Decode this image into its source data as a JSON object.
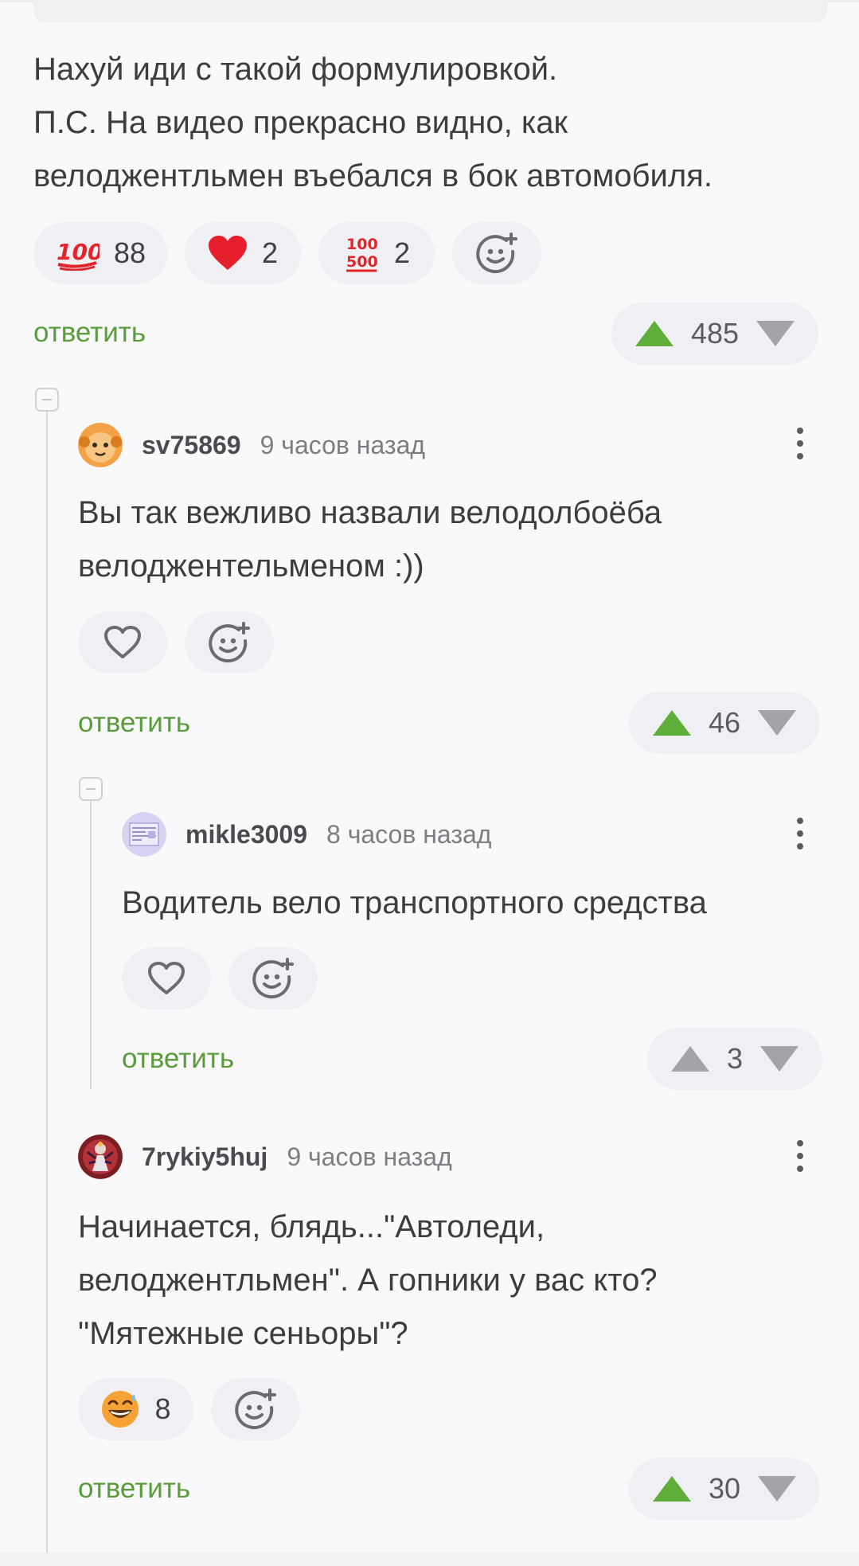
{
  "comment_top": {
    "text": "Нахуй иди с такой формулировкой.\nП.С. На видео прекрасно видно, как\nвелоджентльмен въебался в бок автомобиля.",
    "reactions": [
      {
        "icon": "hundred-emoji-icon",
        "count": "88"
      },
      {
        "icon": "heart-emoji-icon",
        "count": "2"
      },
      {
        "icon": "hundred-five-hundred-emoji-icon",
        "count": "2"
      }
    ],
    "reply": "ответить",
    "rating": "485"
  },
  "comment_sv": {
    "username": "sv75869",
    "time": "9 часов назад",
    "text": "Вы так вежливо назвали велодолбоёба\nвелоджентельменом :))",
    "reply": "ответить",
    "rating": "46"
  },
  "comment_mikle": {
    "username": "mikle3009",
    "time": "8 часов назад",
    "text": "Водитель вело транспортного средства",
    "reply": "ответить",
    "rating": "3"
  },
  "comment_7ry": {
    "username": "7rykiy5huj",
    "time": "9 часов назад",
    "text": "Начинается, блядь...\"Автоледи,\nвелоджентльмен\". А гопники у вас кто?\n\"Мятежные сеньоры\"?",
    "reactions": [
      {
        "icon": "grinning-sweat-emoji-icon",
        "count": "8"
      }
    ],
    "reply": "ответить",
    "rating": "30"
  },
  "colors": {
    "accent_green": "#5fae3a",
    "link_green": "#5a9c3a",
    "background": "#f9f9fb",
    "pill": "#f0f0f4"
  }
}
